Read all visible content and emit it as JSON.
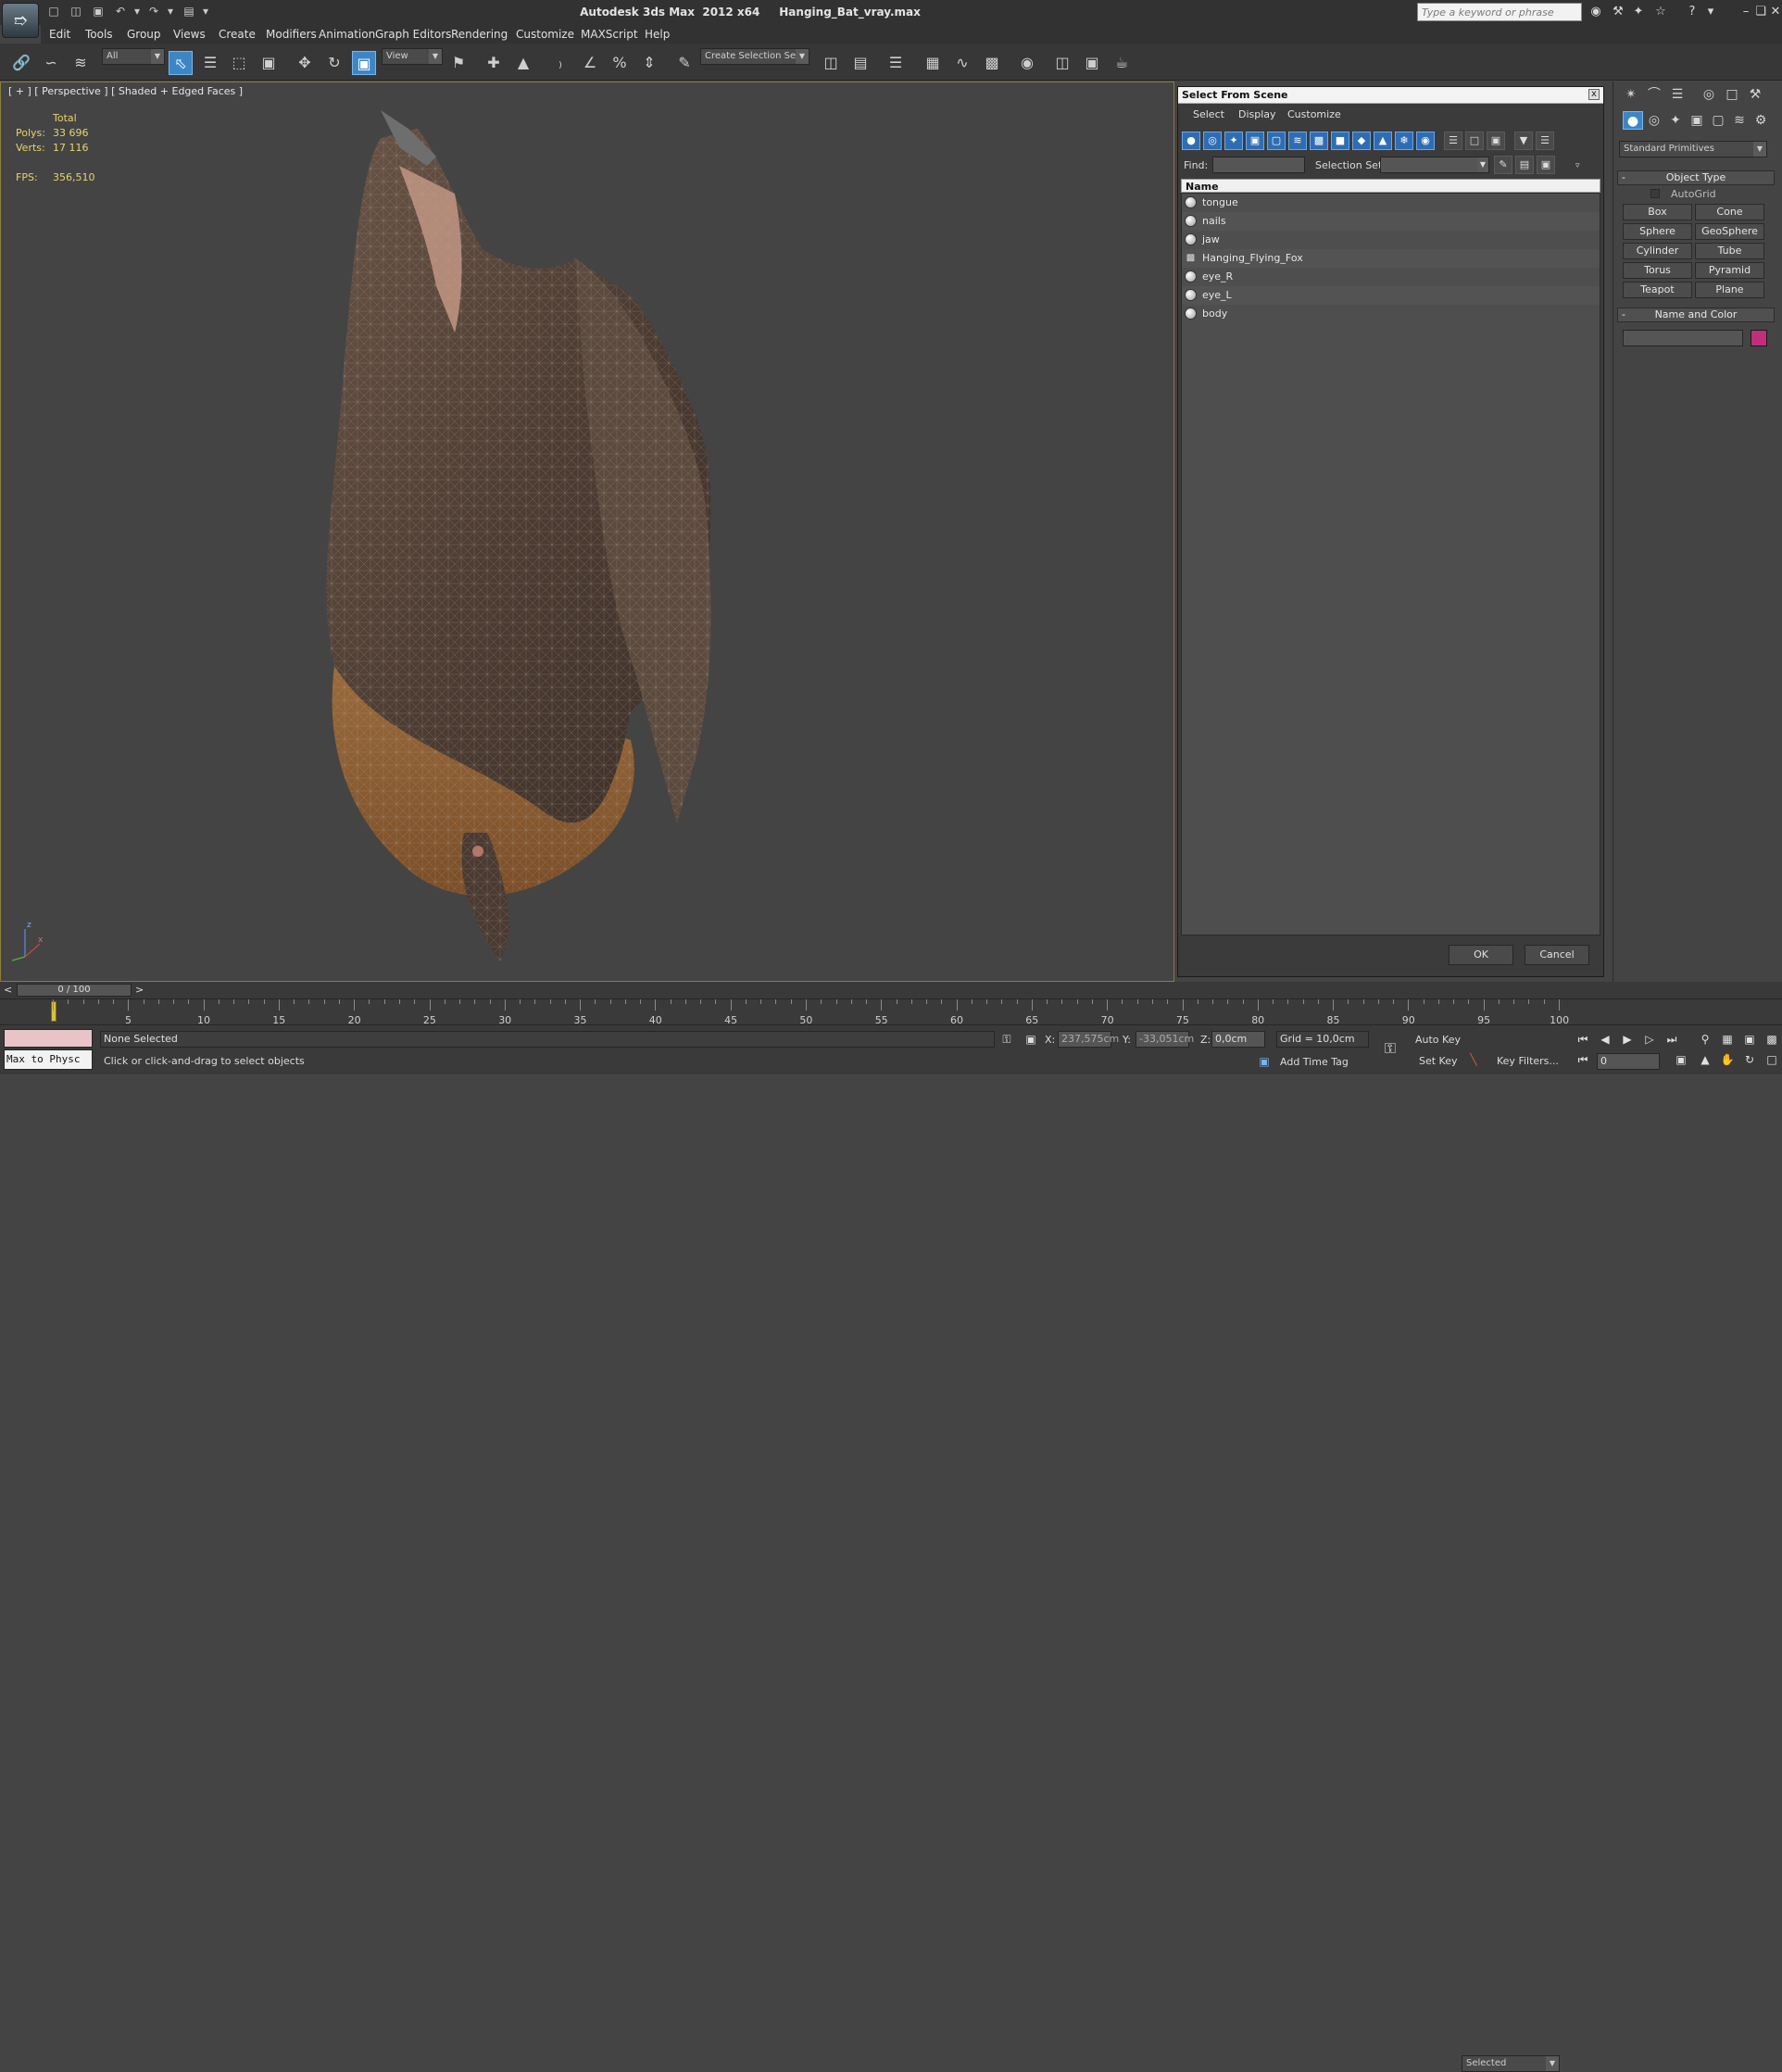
{
  "window": {
    "title": "Autodesk 3ds Max  2012 x64     Hanging_Bat_vray.max",
    "search_placeholder": "Type a keyword or phrase",
    "logo_icon": "3dsmax-logo-icon"
  },
  "menu": [
    "Edit",
    "Tools",
    "Group",
    "Views",
    "Create",
    "Modifiers",
    "Animation",
    "Graph Editors",
    "Rendering",
    "Customize",
    "MAXScript",
    "Help"
  ],
  "toolbar": {
    "filter_value": "All",
    "refcoord_value": "View",
    "selection_set_placeholder": "Create Selection Se"
  },
  "viewport": {
    "label": "[ + ] [ Perspective ] [ Shaded + Edged Faces ]",
    "stats_header": "Total",
    "polys_label": "Polys:",
    "polys_value": "33 696",
    "verts_label": "Verts:",
    "verts_value": "17 116",
    "fps_label": "FPS:",
    "fps_value": "356,510",
    "axis_z": "z",
    "axis_x": "x"
  },
  "dialog": {
    "title": "Select From Scene",
    "close": "x",
    "menus": [
      "Select",
      "Display",
      "Customize"
    ],
    "find_label": "Find:",
    "selection_set_label": "Selection Set:",
    "column_name": "Name",
    "objects": [
      {
        "name": "tongue",
        "type": "geometry"
      },
      {
        "name": "nails",
        "type": "geometry"
      },
      {
        "name": "jaw",
        "type": "geometry"
      },
      {
        "name": "Hanging_Flying_Fox",
        "type": "group"
      },
      {
        "name": "eye_R",
        "type": "geometry"
      },
      {
        "name": "eye_L",
        "type": "geometry"
      },
      {
        "name": "body",
        "type": "geometry"
      }
    ],
    "ok": "OK",
    "cancel": "Cancel"
  },
  "command_panel": {
    "category_value": "Standard Primitives",
    "object_type_title": "Object Type",
    "autogrid_label": "AutoGrid",
    "primitives": [
      "Box",
      "Cone",
      "Sphere",
      "GeoSphere",
      "Cylinder",
      "Tube",
      "Torus",
      "Pyramid",
      "Teapot",
      "Plane"
    ],
    "name_color_title": "Name and Color",
    "color_swatch": "#c0307a",
    "rollout_collapse": "-"
  },
  "timeline": {
    "slider_value": "0 / 100",
    "prev": "<",
    "next": ">",
    "ticks": [
      "5",
      "10",
      "15",
      "20",
      "25",
      "30",
      "35",
      "40",
      "45",
      "50",
      "55",
      "60",
      "65",
      "70",
      "75",
      "80",
      "85",
      "90",
      "95",
      "100"
    ]
  },
  "status": {
    "script_listener": "Max to Physc",
    "selection_text": "None Selected",
    "prompt_text": "Click or click-and-drag to select objects",
    "x_label": "X:",
    "x_value": "237,575cm",
    "y_label": "Y:",
    "y_value": "-33,051cm",
    "z_label": "Z:",
    "z_value": "0,0cm",
    "grid_text": "Grid = 10,0cm",
    "add_time_tag": "Add Time Tag",
    "auto_key": "Auto Key",
    "set_key": "Set Key",
    "key_mode_value": "Selected",
    "key_filters": "Key Filters...",
    "frame_value": "0"
  }
}
